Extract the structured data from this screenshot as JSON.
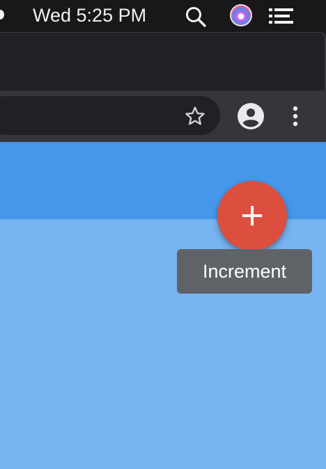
{
  "menubar": {
    "clock": "Wed 5:25 PM",
    "icons": [
      "search-icon",
      "siri-icon",
      "control-center-list-icon"
    ],
    "background": "#18181b"
  },
  "browser": {
    "toolbar_icons": [
      "bookmark-star-icon",
      "account-icon",
      "more-menu-icon"
    ],
    "background": "#35363a"
  },
  "page": {
    "appbar_color": "#4597ea",
    "body_color": "#78b4f1",
    "fab": {
      "icon": "plus-icon",
      "color": "#dc4f3f",
      "tooltip": "Increment"
    }
  }
}
